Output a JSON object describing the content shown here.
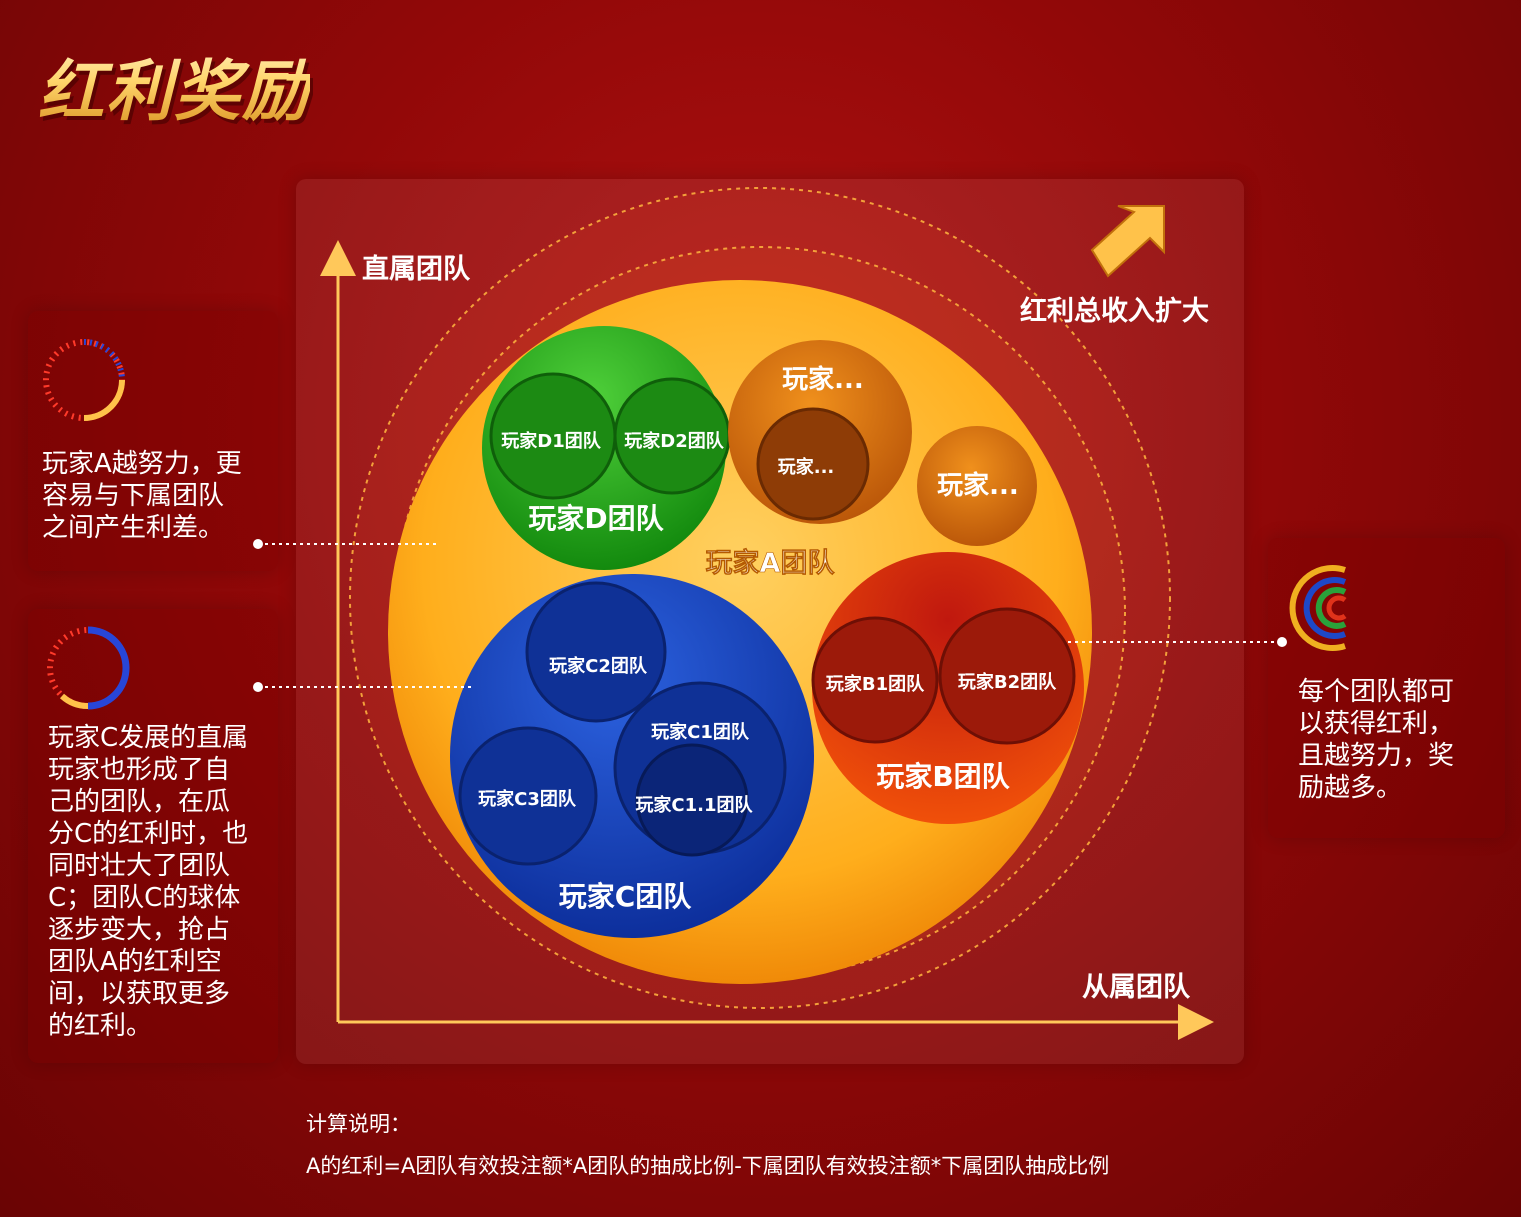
{
  "title": "红利奖励",
  "axes": {
    "y_label": "直属团队",
    "x_label": "从属团队"
  },
  "growth_label": "红利总收入扩大",
  "bubbles": {
    "team_a": "玩家A团队",
    "team_d": "玩家D团队",
    "team_d1": "玩家D1团队",
    "team_d2": "玩家D2团队",
    "orange_1": "玩家...",
    "orange_1_inner": "玩家...",
    "orange_2": "玩家...",
    "team_b": "玩家B团队",
    "team_b1": "玩家B1团队",
    "team_b2": "玩家B2团队",
    "team_c": "玩家C团队",
    "team_c1": "玩家C1团队",
    "team_c1_1": "玩家C1.1团队",
    "team_c2": "玩家C2团队",
    "team_c3": "玩家C3团队"
  },
  "notes": {
    "left_top": [
      "玩家A越努力，更",
      "容易与下属团队",
      "之间产生利差。"
    ],
    "left_bottom": [
      "玩家C发展的直属",
      "玩家也形成了自",
      "己的团队，在瓜",
      "分C的红利时，也",
      "同时壮大了团队",
      "C；团队C的球体",
      "逐步变大，抢占",
      "团队A的红利空",
      "间，以获取更多",
      "的红利。"
    ],
    "right": [
      "每个团队都可",
      "以获得红利，",
      "且越努力，奖",
      "励越多。"
    ]
  },
  "footer": {
    "title": "计算说明：",
    "formula": "A的红利=A团队有效投注额*A团队的抽成比例-下属团队有效投注额*下属团队抽成比例"
  },
  "colors": {
    "background": "#920808",
    "team_a": "#ffb21e",
    "team_b": "#e8340c",
    "team_c": "#1b47c4",
    "team_d": "#2fa81c",
    "orange": "#e0780f",
    "gold": "#ffc85a"
  }
}
